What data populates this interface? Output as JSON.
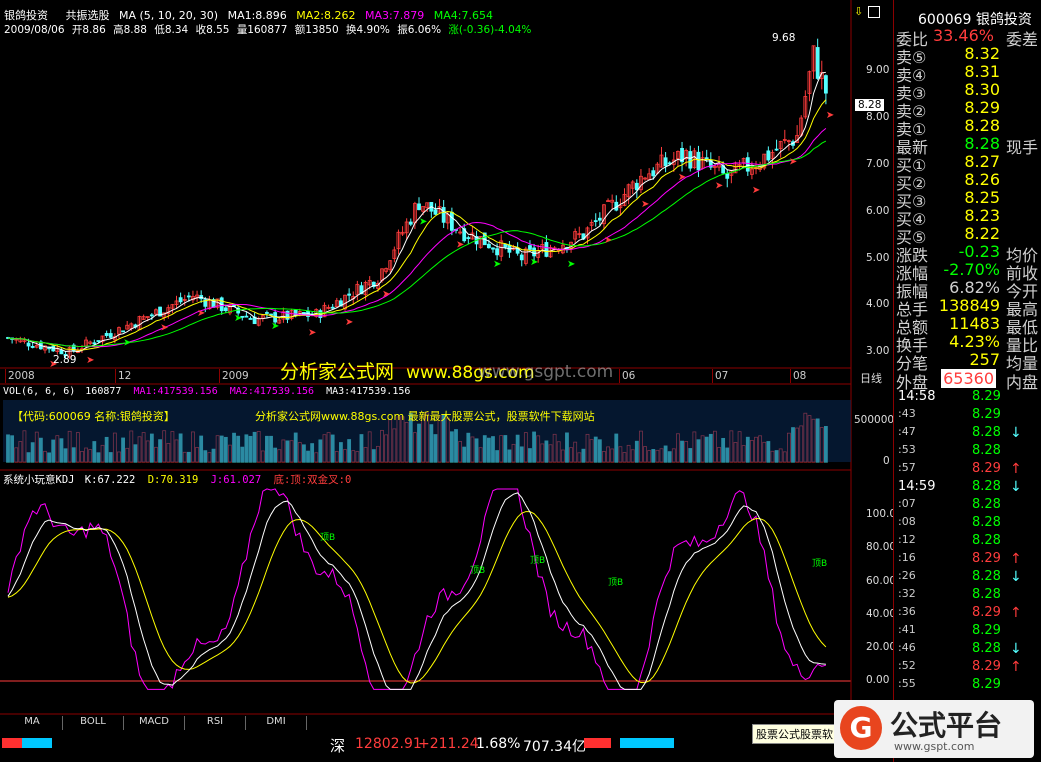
{
  "header": {
    "stock_name": "银鸽投资",
    "indicator": "共振选股",
    "ma_label": "MA (5, 10, 20, 30)",
    "ma1": "MA1:8.896",
    "ma2": "MA2:8.262",
    "ma3": "MA3:7.879",
    "ma4": "MA4:7.654",
    "date": "2009/08/06",
    "open": "开8.86",
    "high": "高8.88",
    "low": "低8.34",
    "close": "收8.55",
    "volume": "量160877",
    "amount": "额13850",
    "turnover": "换4.90%",
    "amplitude": "振6.06%",
    "change": "涨(-0.36)-4.04%"
  },
  "price_axis": [
    "9.00",
    "8.00",
    "7.00",
    "6.00",
    "5.00",
    "4.00",
    "3.00"
  ],
  "price_marks": {
    "high": "9.68",
    "low": "2.89",
    "current": "8.28"
  },
  "x_axis": [
    "2008",
    "12",
    "2009",
    "06",
    "07",
    "08"
  ],
  "x_axis_right": "日线",
  "watermark": {
    "main": "分析家公式网",
    "url": "www.88gs.com",
    "small": "www.gsgpt.com"
  },
  "volume_pane": {
    "title": "VOL(6, 6, 6)",
    "vol": "160877",
    "ma1": "MA1:417539.156",
    "ma2": "MA2:417539.156",
    "ma3": "MA3:417539.156",
    "banner_left": "【代码:600069 名称:银鸽投资】",
    "banner_right": "分析家公式网www.88gs.com 最新最大股票公式，股票软件下载网站",
    "axis": [
      "500000",
      "0"
    ]
  },
  "kdj_pane": {
    "title": "系统小玩意KDJ",
    "k": "K:67.222",
    "d": "D:70.319",
    "j": "J:61.027",
    "extra": "底:顶:双金叉:0",
    "axis": [
      "100.00",
      "80.00",
      "60.00",
      "40.00",
      "20.00",
      "0.00"
    ],
    "signal": "顶B"
  },
  "bottom_tabs": [
    "MA",
    "BOLL",
    "MACD",
    "RSI",
    "DMI"
  ],
  "status_bar": {
    "market": "深",
    "index": "12802.91",
    "change": "+211.24",
    "pct": "1.68%",
    "amount": "707.34亿",
    "ad": "股票公式股票软"
  },
  "right_panel": {
    "code": "600069",
    "name": "银鸽投资",
    "weibi_label": "委比",
    "weibi": "33.46%",
    "weicha_label": "委差",
    "asks": [
      {
        "label": "卖⑤",
        "price": "8.32"
      },
      {
        "label": "卖④",
        "price": "8.31"
      },
      {
        "label": "卖③",
        "price": "8.30"
      },
      {
        "label": "卖②",
        "price": "8.29"
      },
      {
        "label": "卖①",
        "price": "8.28"
      }
    ],
    "last_label": "最新",
    "last": "8.28",
    "xianshou_label": "现手",
    "bids": [
      {
        "label": "买①",
        "price": "8.27"
      },
      {
        "label": "买②",
        "price": "8.26"
      },
      {
        "label": "买③",
        "price": "8.25"
      },
      {
        "label": "买④",
        "price": "8.23"
      },
      {
        "label": "买⑤",
        "price": "8.22"
      }
    ],
    "stats": [
      {
        "k": "涨跌",
        "v": "-0.23",
        "k2": "均价",
        "color": "#00ff00"
      },
      {
        "k": "涨幅",
        "v": "-2.70%",
        "k2": "前收",
        "color": "#00ff00"
      },
      {
        "k": "振幅",
        "v": "6.82%",
        "k2": "今开",
        "color": "#d0d0d0"
      },
      {
        "k": "总手",
        "v": "138849",
        "k2": "最高",
        "color": "#ffff00"
      },
      {
        "k": "总额",
        "v": "11483",
        "k2": "最低",
        "color": "#ffff00"
      },
      {
        "k": "换手",
        "v": "4.23%",
        "k2": "量比",
        "color": "#ffff00"
      },
      {
        "k": "分笔",
        "v": "257",
        "k2": "均量",
        "color": "#ffff00"
      }
    ],
    "waipan_label": "外盘",
    "waipan": "65360",
    "neipan_label": "内盘",
    "ticks": [
      {
        "t": "14:58",
        "p": "8.29",
        "dir": ""
      },
      {
        "t": ":43",
        "p": "8.29",
        "dir": ""
      },
      {
        "t": ":47",
        "p": "8.28",
        "dir": "↓"
      },
      {
        "t": ":53",
        "p": "8.28",
        "dir": ""
      },
      {
        "t": ":57",
        "p": "8.29",
        "dir": "↑"
      },
      {
        "t": "14:59",
        "p": "8.28",
        "dir": "↓"
      },
      {
        "t": ":07",
        "p": "8.28",
        "dir": ""
      },
      {
        "t": ":08",
        "p": "8.28",
        "dir": ""
      },
      {
        "t": ":12",
        "p": "8.28",
        "dir": ""
      },
      {
        "t": ":16",
        "p": "8.29",
        "dir": "↑"
      },
      {
        "t": ":26",
        "p": "8.28",
        "dir": "↓"
      },
      {
        "t": ":32",
        "p": "8.28",
        "dir": ""
      },
      {
        "t": ":36",
        "p": "8.29",
        "dir": "↑"
      },
      {
        "t": ":41",
        "p": "8.29",
        "dir": ""
      },
      {
        "t": ":46",
        "p": "8.28",
        "dir": "↓"
      },
      {
        "t": ":52",
        "p": "8.29",
        "dir": "↑"
      },
      {
        "t": ":55",
        "p": "8.29",
        "dir": ""
      }
    ]
  },
  "logo": {
    "text": "公式平台",
    "url": "www.gspt.com"
  },
  "colors": {
    "up": "#ff3c3c",
    "down": "#54ffff",
    "ma1": "#ffffff",
    "ma2": "#ffff00",
    "ma3": "#ff00ff",
    "ma4": "#00ff00",
    "axis": "#8b0000"
  }
}
